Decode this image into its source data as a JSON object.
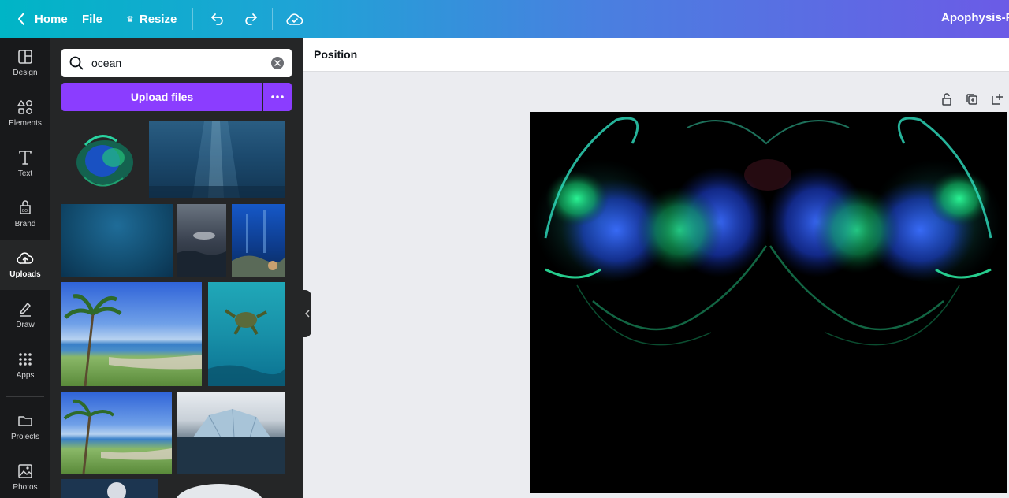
{
  "topbar": {
    "home_label": "Home",
    "file_label": "File",
    "resize_label": "Resize",
    "title": "Apophysis-Rec"
  },
  "rail": {
    "items": [
      {
        "label": "Design",
        "icon": "layout-icon"
      },
      {
        "label": "Elements",
        "icon": "shapes-icon"
      },
      {
        "label": "Text",
        "icon": "text-icon"
      },
      {
        "label": "Brand",
        "icon": "brand-icon"
      },
      {
        "label": "Uploads",
        "icon": "cloud-upload-icon",
        "active": true
      },
      {
        "label": "Draw",
        "icon": "pen-icon"
      },
      {
        "label": "Apps",
        "icon": "grid-icon"
      },
      {
        "label": "Projects",
        "icon": "folder-icon"
      },
      {
        "label": "Photos",
        "icon": "image-icon"
      }
    ]
  },
  "panel": {
    "search_value": "ocean",
    "upload_label": "Upload files"
  },
  "toolbar": {
    "position_label": "Position"
  },
  "colors": {
    "accent": "#8b3dff",
    "rail_bg": "#18191b",
    "panel_bg": "#252627",
    "canvas_bg": "#ebecf0"
  }
}
